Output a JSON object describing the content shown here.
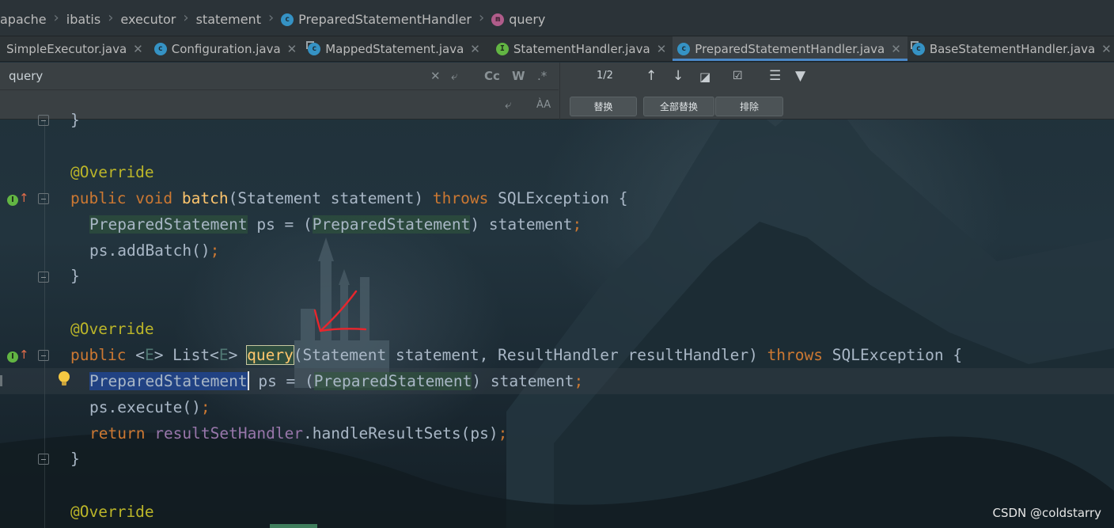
{
  "breadcrumb": {
    "items": [
      {
        "label": "apache",
        "icon": null
      },
      {
        "label": "ibatis",
        "icon": null
      },
      {
        "label": "executor",
        "icon": null
      },
      {
        "label": "statement",
        "icon": null
      },
      {
        "label": "PreparedStatementHandler",
        "icon": "class-icon"
      },
      {
        "label": "query",
        "icon": "method-icon"
      }
    ],
    "class_icon_letter": "c",
    "method_icon_letter": "m"
  },
  "tabs": [
    {
      "label": "SimpleExecutor.java",
      "icon": "class-icon",
      "active": false
    },
    {
      "label": "Configuration.java",
      "icon": "class-icon",
      "active": false
    },
    {
      "label": "MappedStatement.java",
      "icon": "class-icon",
      "active": false
    },
    {
      "label": "StatementHandler.java",
      "icon": "interface-icon",
      "active": false
    },
    {
      "label": "PreparedStatementHandler.java",
      "icon": "class-icon",
      "active": true
    },
    {
      "label": "BaseStatementHandler.java",
      "icon": "abstract-class-icon",
      "active": false
    }
  ],
  "find": {
    "search_value": "query",
    "match_count": "1/2",
    "options": [
      "Cc",
      "W",
      ".*"
    ],
    "replace_value": "",
    "buttons": {
      "replace": "替换",
      "replace_all": "全部替换",
      "exclude": "排除"
    }
  },
  "colors": {
    "keyword": "#cc7832",
    "annotation": "#bbb529",
    "method": "#ffc66d",
    "field": "#9876aa",
    "selection": "#214283",
    "accent_tab": "#4a88c7"
  },
  "code": {
    "l0": "}",
    "override1": "@Override",
    "batch_public": "public",
    "batch_void": "void",
    "batch_name": "batch",
    "batch_params": "(Statement statement) ",
    "batch_throws": "throws",
    "batch_exc": " SQLException {",
    "b_type": "PreparedStatement",
    "b_rest1": " ps = (",
    "b_cast": "PreparedStatement",
    "b_rest2": ") statement",
    "b_semi": ";",
    "b_add": "ps.addBatch()",
    "b_add_semi": ";",
    "b_close": "}",
    "override2": "@Override",
    "q_public": "public",
    "q_lt": " <",
    "q_E1": "E",
    "q_list": "> List<",
    "q_E2": "E",
    "q_gt": "> ",
    "q_name": "query",
    "q_params": "(Statement statement, ResultHandler resultHandler) ",
    "q_throws": "throws",
    "q_exc": " SQLException {",
    "q_type": "PreparedStatement",
    "q_rest1": " ps = (",
    "q_cast": "PreparedStatement",
    "q_rest2": ") statement",
    "q_semi": ";",
    "q_exec": "ps.execute()",
    "q_exec_semi": ";",
    "q_return": "return",
    "q_field": "resultSetHandler",
    "q_call": ".handleResultSets(ps)",
    "q_call_semi": ";",
    "q_close": "}",
    "override3": "@Override"
  },
  "watermark": "CSDN @coldstarry"
}
